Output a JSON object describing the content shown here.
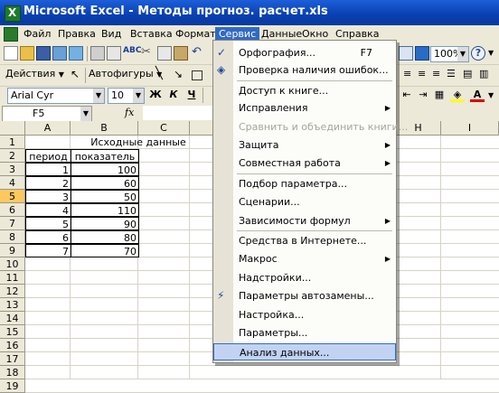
{
  "window": {
    "title": "Microsoft Excel - Методы прогноз. расчет.xls"
  },
  "menubar": [
    "Файл",
    "Правка",
    "Вид",
    "Вставка",
    "Формат",
    "Сервис",
    "Данные",
    "Окно",
    "Справка"
  ],
  "toolbar": {
    "zoom": "100%",
    "actions_label": "Действия",
    "autoshapes_label": "Автофигуры",
    "font_name": "Arial Cyr",
    "font_size": "10",
    "bold": "Ж",
    "italic": "К",
    "underline": "Ч"
  },
  "formula_bar": {
    "name_box": "F5",
    "fx": "fx",
    "content": ""
  },
  "grid": {
    "columns": [
      "A",
      "B",
      "C",
      "H",
      "I"
    ],
    "rows": [
      "1",
      "2",
      "3",
      "4",
      "5",
      "6",
      "7",
      "8",
      "9",
      "10",
      "11",
      "12",
      "13",
      "14",
      "15",
      "16",
      "17",
      "18",
      "19"
    ],
    "selected_row": "5",
    "title_cell": "Исходные данные",
    "headers": [
      "период",
      "показатель"
    ],
    "data": [
      [
        "1",
        "100"
      ],
      [
        "2",
        "60"
      ],
      [
        "3",
        "50"
      ],
      [
        "4",
        "110"
      ],
      [
        "5",
        "90"
      ],
      [
        "6",
        "80"
      ],
      [
        "7",
        "70"
      ]
    ]
  },
  "dropdown": {
    "items": [
      {
        "label": "Орфография...",
        "shortcut": "F7",
        "icon": "spelling-icon"
      },
      {
        "label": "Проверка наличия ошибок...",
        "icon": "error-check-icon"
      },
      {
        "label": "Доступ к книге..."
      },
      {
        "label": "Исправления",
        "submenu": true
      },
      {
        "label": "Сравнить и объединить книги...",
        "disabled": true
      },
      {
        "label": "Защита",
        "submenu": true
      },
      {
        "label": "Совместная работа",
        "submenu": true
      },
      {
        "label": "Подбор параметра..."
      },
      {
        "label": "Сценарии..."
      },
      {
        "label": "Зависимости формул",
        "submenu": true
      },
      {
        "label": "Средства в Интернете..."
      },
      {
        "label": "Макрос",
        "submenu": true
      },
      {
        "label": "Надстройки..."
      },
      {
        "label": "Параметры автозамены...",
        "icon": "autocorrect-icon"
      },
      {
        "label": "Настройка..."
      },
      {
        "label": "Параметры..."
      },
      {
        "label": "Анализ данных...",
        "highlighted": true
      }
    ]
  },
  "colors": {
    "title_bar": "#0a3fb0",
    "menu_bg": "#ece9d8",
    "highlight": "#316ac5",
    "selected_header": "#ffc85f"
  }
}
